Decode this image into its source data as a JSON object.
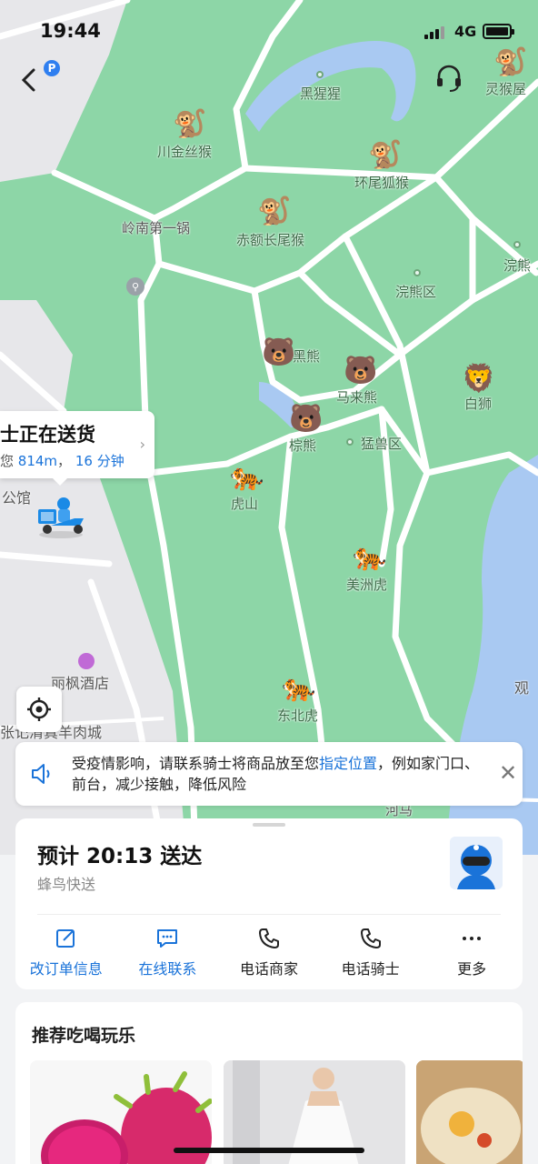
{
  "status_bar": {
    "time": "19:44",
    "network": "4G"
  },
  "map": {
    "labels": [
      {
        "id": "gorilla",
        "text": "黑猩猩"
      },
      {
        "id": "golden-monkey",
        "text": "川金丝猴"
      },
      {
        "id": "lemur",
        "text": "环尾狐猴"
      },
      {
        "id": "spirit-house",
        "text": "灵猴屋"
      },
      {
        "id": "restaurant",
        "text": "岭南第一锅"
      },
      {
        "id": "macaque",
        "text": "赤额长尾猴"
      },
      {
        "id": "raccoon",
        "text": "浣熊"
      },
      {
        "id": "raccoon-area",
        "text": "浣熊区"
      },
      {
        "id": "black-bear",
        "text": "黑熊"
      },
      {
        "id": "sun-bear",
        "text": "马来熊"
      },
      {
        "id": "white-lion",
        "text": "白狮"
      },
      {
        "id": "brown-bear",
        "text": "棕熊"
      },
      {
        "id": "beast-area",
        "text": "猛兽区"
      },
      {
        "id": "tiger-hill",
        "text": "虎山"
      },
      {
        "id": "american-tiger",
        "text": "美洲虎"
      },
      {
        "id": "ne-tiger",
        "text": "东北虎"
      },
      {
        "id": "hotel",
        "text": "丽枫酒店"
      },
      {
        "id": "mutton",
        "text": "张记清真羊肉城"
      },
      {
        "id": "museum",
        "text": "公馆"
      },
      {
        "id": "view",
        "text": "观"
      },
      {
        "id": "river",
        "text": "河马"
      }
    ]
  },
  "rider_bubble": {
    "title": "士正在送货",
    "prefix": "您",
    "distance": "814m",
    "separator": "，",
    "minutes": "16 分钟"
  },
  "notice": {
    "text_before": "受疫情影响，请联系骑士将商品放至您",
    "highlight": "指定位置",
    "text_after": "，例如家门口、前台，减少接触，降低风险"
  },
  "order": {
    "eta": "预计 20:13 送达",
    "carrier": "蜂鸟快送",
    "actions": [
      {
        "label": "改订单信息",
        "icon": "edit-icon"
      },
      {
        "label": "在线联系",
        "icon": "chat-icon"
      },
      {
        "label": "电话商家",
        "icon": "phone-icon"
      },
      {
        "label": "电话骑士",
        "icon": "phone-icon"
      },
      {
        "label": "更多",
        "icon": "more-icon"
      }
    ]
  },
  "recommend": {
    "title": "推荐吃喝玩乐"
  },
  "colors": {
    "accent": "#1a73d9",
    "map_green": "#8dd6a7",
    "water": "#a9c9f2"
  }
}
